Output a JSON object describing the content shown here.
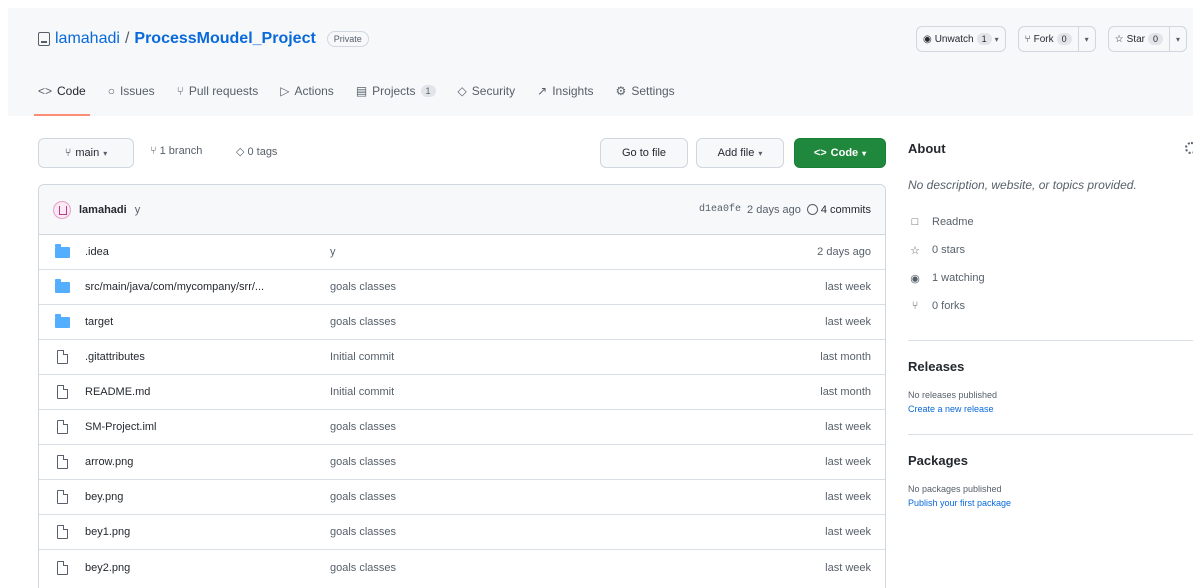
{
  "repo": {
    "owner": "lamahadi",
    "separator": "/",
    "name": "ProcessMoudel_Project",
    "visibility": "Private"
  },
  "header_actions": {
    "watch": {
      "label": "Unwatch",
      "count": "1"
    },
    "fork": {
      "label": "Fork",
      "count": "0"
    },
    "star": {
      "label": "Star",
      "count": "0"
    }
  },
  "tabs": [
    {
      "label": "Code",
      "icon": "code-icon",
      "glyph": "<>"
    },
    {
      "label": "Issues",
      "icon": "issue-icon",
      "glyph": "○"
    },
    {
      "label": "Pull requests",
      "icon": "pull-request-icon",
      "glyph": "⑂"
    },
    {
      "label": "Actions",
      "icon": "play-icon",
      "glyph": "▷"
    },
    {
      "label": "Projects",
      "icon": "project-icon",
      "glyph": "▤",
      "count": "1"
    },
    {
      "label": "Security",
      "icon": "shield-icon",
      "glyph": "◇"
    },
    {
      "label": "Insights",
      "icon": "graph-icon",
      "glyph": "↗"
    },
    {
      "label": "Settings",
      "icon": "gear-icon",
      "glyph": "⚙"
    }
  ],
  "branch_bar": {
    "branch": "main",
    "branches": "1 branch",
    "tags": "0 tags",
    "go_to_file": "Go to file",
    "add_file": "Add file",
    "code": "Code"
  },
  "latest_commit": {
    "author": "lamahadi",
    "message": "y",
    "hash": "d1ea0fe",
    "time": "2 days ago",
    "commits": "4 commits"
  },
  "files": [
    {
      "type": "folder",
      "name": ".idea",
      "message": "y",
      "date": "2 days ago"
    },
    {
      "type": "folder",
      "name": "src/main/java/com/mycompany/srr/...",
      "message": "goals classes",
      "date": "last week"
    },
    {
      "type": "folder",
      "name": "target",
      "message": "goals classes",
      "date": "last week"
    },
    {
      "type": "file",
      "name": ".gitattributes",
      "message": "Initial commit",
      "date": "last month"
    },
    {
      "type": "file",
      "name": "README.md",
      "message": "Initial commit",
      "date": "last month"
    },
    {
      "type": "file",
      "name": "SM-Project.iml",
      "message": "goals classes",
      "date": "last week"
    },
    {
      "type": "file",
      "name": "arrow.png",
      "message": "goals classes",
      "date": "last week"
    },
    {
      "type": "file",
      "name": "bey.png",
      "message": "goals classes",
      "date": "last week"
    },
    {
      "type": "file",
      "name": "bey1.png",
      "message": "goals classes",
      "date": "last week"
    },
    {
      "type": "file",
      "name": "bey2.png",
      "message": "goals classes",
      "date": "last week"
    }
  ],
  "about": {
    "title": "About",
    "description": "No description, website, or topics provided.",
    "items": [
      {
        "icon": "book-icon",
        "glyph": "□",
        "label": "Readme"
      },
      {
        "icon": "star-icon",
        "glyph": "☆",
        "label": "0 stars"
      },
      {
        "icon": "eye-icon",
        "glyph": "◉",
        "label": "1 watching"
      },
      {
        "icon": "fork-icon",
        "glyph": "⑂",
        "label": "0 forks"
      }
    ]
  },
  "releases": {
    "title": "Releases",
    "note": "No releases published",
    "link": "Create a new release"
  },
  "packages": {
    "title": "Packages",
    "note": "No packages published",
    "link": "Publish your first package"
  }
}
